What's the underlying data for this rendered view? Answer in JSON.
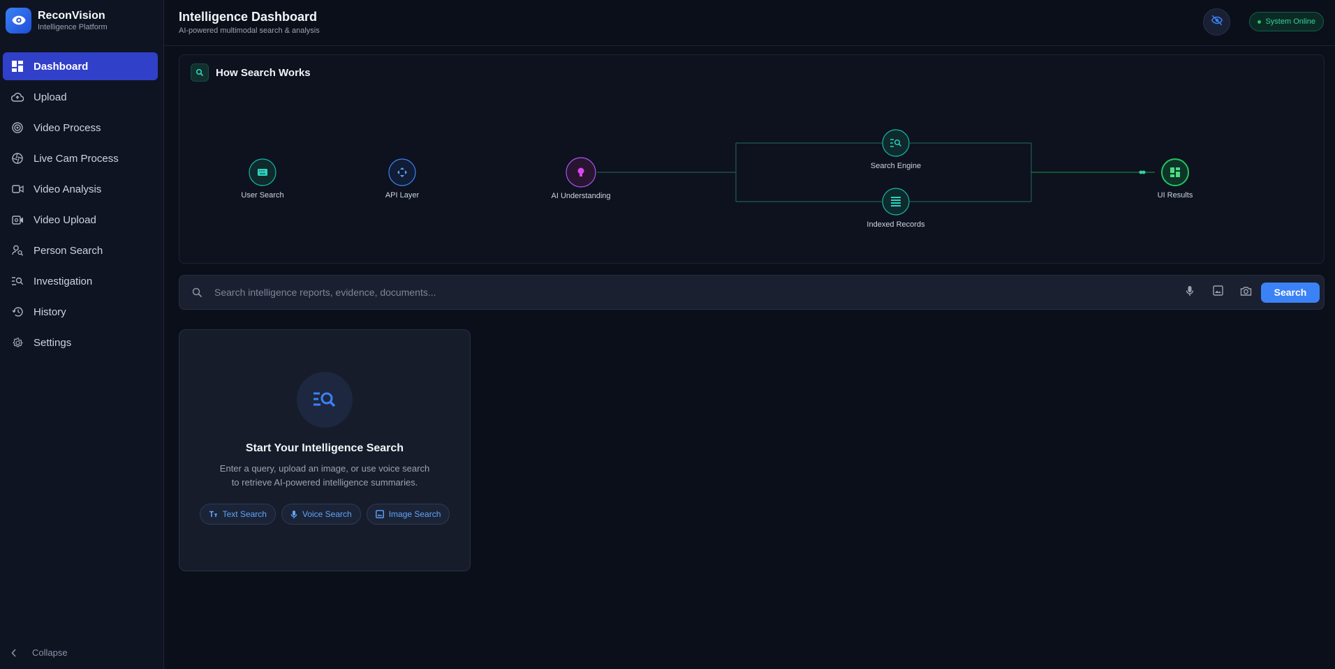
{
  "brand": {
    "name": "ReconVision",
    "subtitle": "Intelligence Platform",
    "logo_icon": "eye-icon"
  },
  "sidebar": {
    "items": [
      {
        "label": "Dashboard",
        "icon": "dashboard-icon",
        "active": true
      },
      {
        "label": "Upload",
        "icon": "cloud-upload-icon"
      },
      {
        "label": "Video Process",
        "icon": "target-icon"
      },
      {
        "label": "Live Cam Process",
        "icon": "shutter-icon"
      },
      {
        "label": "Video Analysis",
        "icon": "videocam-icon"
      },
      {
        "label": "Video Upload",
        "icon": "video-settings-icon"
      },
      {
        "label": "Person Search",
        "icon": "person-search-icon"
      },
      {
        "label": "Investigation",
        "icon": "manage-search-icon"
      },
      {
        "label": "History",
        "icon": "history-icon"
      },
      {
        "label": "Settings",
        "icon": "gear-icon"
      }
    ],
    "collapse_label": "Collapse"
  },
  "header": {
    "title": "Intelligence Dashboard",
    "subtitle": "AI-powered multimodal search & analysis",
    "status": "System Online"
  },
  "flow": {
    "title": "How Search Works",
    "nodes": {
      "user_search": "User Search",
      "api_layer": "API Layer",
      "ai_understanding": "AI Understanding",
      "search_engine": "Search Engine",
      "indexed_records": "Indexed Records",
      "ui_results": "UI Results"
    }
  },
  "search": {
    "placeholder": "Search intelligence reports, evidence, documents...",
    "value": "",
    "button_label": "Search"
  },
  "start_card": {
    "title": "Start Your Intelligence Search",
    "description_line1": "Enter a query, upload an image, or use voice search",
    "description_line2": "to retrieve AI-powered intelligence summaries.",
    "pills": [
      "Text Search",
      "Voice Search",
      "Image Search"
    ]
  },
  "colors": {
    "accent_blue": "#3b82f6",
    "active_nav": "#3140c9",
    "teal": "#14b8a6",
    "purple": "#a855f7",
    "green": "#34d399"
  }
}
